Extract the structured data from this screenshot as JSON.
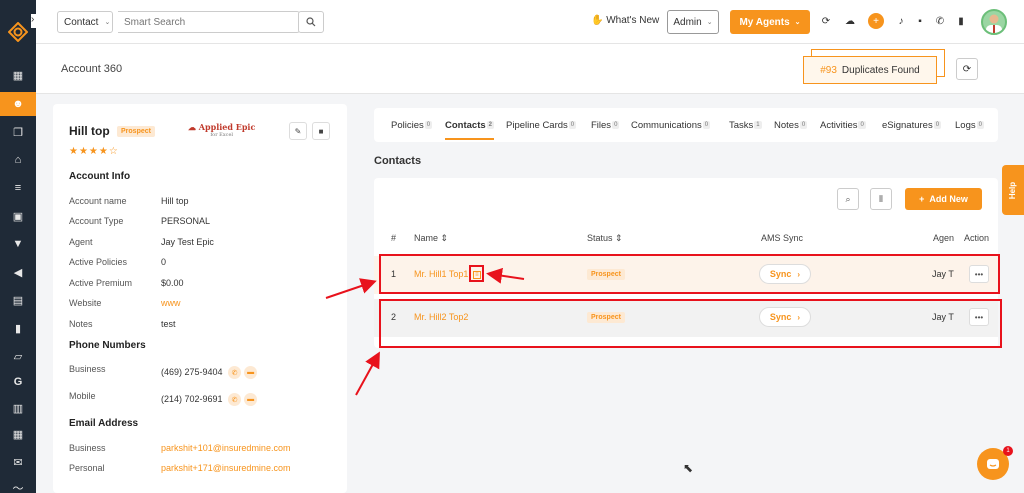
{
  "topbar": {
    "module_select": "Contact",
    "search_placeholder": "Smart Search",
    "whats_new": "What's New",
    "role_select": "Admin",
    "my_agents": "My Agents"
  },
  "header": {
    "page_title": "Account 360",
    "duplicates_count": "#93",
    "duplicates_label": "Duplicates Found"
  },
  "account": {
    "name": "Hill top",
    "status": "Prospect",
    "stars": "★★★★☆",
    "integration_logo": "Applied Epic",
    "integration_sub": "for Excel",
    "info_title": "Account Info",
    "fields": [
      {
        "label": "Account name",
        "value": "Hill top",
        "link": false
      },
      {
        "label": "Account Type",
        "value": "PERSONAL",
        "link": false
      },
      {
        "label": "Agent",
        "value": "Jay Test Epic",
        "link": false
      },
      {
        "label": "Active Policies",
        "value": "0",
        "link": false
      },
      {
        "label": "Active Premium",
        "value": "$0.00",
        "link": false
      },
      {
        "label": "Website",
        "value": "www",
        "link": true
      },
      {
        "label": "Notes",
        "value": "test",
        "link": false
      }
    ],
    "phone_title": "Phone Numbers",
    "phones": [
      {
        "label": "Business",
        "value": "(469) 275-9404"
      },
      {
        "label": "Mobile",
        "value": "(214) 702-9691"
      }
    ],
    "email_title": "Email Address",
    "emails": [
      {
        "label": "Business",
        "value": "parkshit+101@insuredmine.com"
      },
      {
        "label": "Personal",
        "value": "parkshit+171@insuredmine.com"
      }
    ]
  },
  "tabs": [
    {
      "label": "Policies",
      "count": "0"
    },
    {
      "label": "Contacts",
      "count": "2"
    },
    {
      "label": "Pipeline Cards",
      "count": "0"
    },
    {
      "label": "Files",
      "count": "0"
    },
    {
      "label": "Communications",
      "count": "0"
    },
    {
      "label": "Tasks",
      "count": "1"
    },
    {
      "label": "Notes",
      "count": "0"
    },
    {
      "label": "Activities",
      "count": "0"
    },
    {
      "label": "eSignatures",
      "count": "0"
    },
    {
      "label": "Logs",
      "count": "0"
    }
  ],
  "contacts": {
    "title": "Contacts",
    "add_new": "Add New",
    "columns": {
      "num": "#",
      "name": "Name ⇕",
      "status": "Status ⇕",
      "ams_sync": "AMS Sync",
      "agent": "Agen",
      "action": "Action"
    },
    "rows": [
      {
        "num": "1",
        "name": "Mr. Hill1 Top1",
        "status": "Prospect",
        "sync": "Sync",
        "agent": "Jay T"
      },
      {
        "num": "2",
        "name": "Mr. Hill2 Top2",
        "status": "Prospect",
        "sync": "Sync",
        "agent": "Jay T"
      }
    ]
  },
  "help_label": "Help",
  "chat_badge": "1",
  "colors": {
    "accent": "#f7941d",
    "sidebar": "#1f2a37",
    "annotation": "#e8121c"
  }
}
